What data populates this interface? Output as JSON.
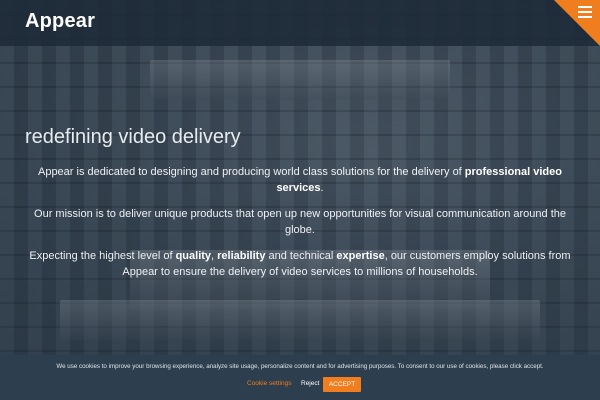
{
  "header": {
    "logo_text": "Appear",
    "menu_icon": "hamburger-menu-icon",
    "accent_color": "#f07d1e"
  },
  "hero": {
    "tagline": "redefining video delivery",
    "para1": {
      "before": "Appear is dedicated to designing and producing world class solutions for the delivery of ",
      "bold": "professional video services",
      "after": "."
    },
    "para2": "Our mission is to deliver unique products that open up new opportunities for visual communication around the globe.",
    "para3": {
      "t1": "Expecting the highest level of ",
      "b1": "quality",
      "t2": ", ",
      "b2": "reliability",
      "t3": " and technical ",
      "b3": "expertise",
      "t4": ", our customers employ solutions from Appear to ensure the delivery of video services to millions of households."
    }
  },
  "cookie_banner": {
    "message": "We use cookies to improve your browsing experience, analyze site usage, personalize content and for advertising purposes. To consent to our use of cookies, please click accept.",
    "settings_label": "Cookie settings",
    "reject_label": "Reject",
    "accept_label": "ACCEPT"
  }
}
